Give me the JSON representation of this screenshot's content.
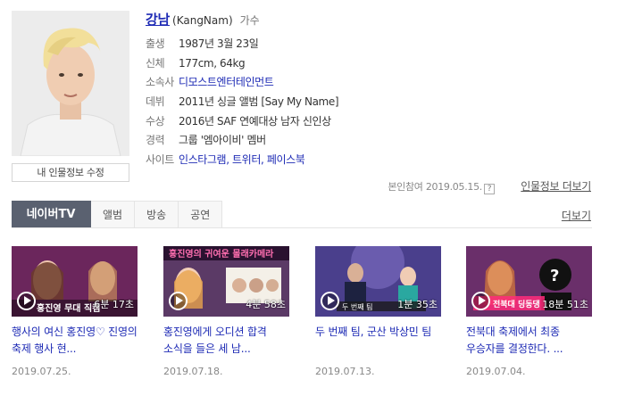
{
  "profile": {
    "name": "강남",
    "name_en": "(KangNam)",
    "job": "가수",
    "edit_button": "내 인물정보 수정",
    "rows": [
      {
        "label": "출생",
        "value": "1987년 3월 23일"
      },
      {
        "label": "신체",
        "value": "177cm, 64kg"
      },
      {
        "label": "소속사",
        "value": "디모스트엔터테인먼트"
      },
      {
        "label": "데뷔",
        "value": "2011년 싱글 앨범 [Say My Name]"
      },
      {
        "label": "수상",
        "value": "2016년 SAF 연예대상 남자 신인상"
      },
      {
        "label": "경력",
        "value": "그룹 '엠아이비' 멤버"
      },
      {
        "label": "사이트",
        "links": [
          "인스타그램",
          "트위터",
          "페이스북"
        ]
      }
    ],
    "verify_text": "본인참여 2019.05.15.",
    "help_mark": "?",
    "more_info": "인물정보 더보기"
  },
  "tabs": [
    {
      "label": "네이버TV",
      "active": true
    },
    {
      "label": "앨범",
      "active": false
    },
    {
      "label": "방송",
      "active": false
    },
    {
      "label": "공연",
      "active": false
    }
  ],
  "more_link": "더보기",
  "videos": [
    {
      "title": "행사의 여신 홍진영♡ 진영의 축제 행사 현...",
      "date": "2019.07.25.",
      "duration": "6분 17초",
      "overlay": "홍진영 무대 직캠",
      "bg": "#3a1f4d"
    },
    {
      "title": "홍진영에게 오디션 합격 소식을 들은 세 남...",
      "date": "2019.07.18.",
      "duration": "4분 58초",
      "overlay": "홍진영의 귀여운 몰래카메라",
      "bg": "#5b3a66"
    },
    {
      "title": "두 번째 팀, 군산 박상민 팀",
      "date": "2019.07.13.",
      "duration": "1분 35초",
      "overlay": "두 번째 팀",
      "bg": "#4a3f8c"
    },
    {
      "title": "전북대 축제에서 최종 우승자를 결정한다. ...",
      "date": "2019.07.04.",
      "duration": "18분 51초",
      "overlay": "전북대 딩동댕",
      "bg": "#6a2f6a"
    }
  ],
  "colors": {
    "link": "#1e2bb5",
    "tab_active": "#5a6170",
    "accent_pink": "#ff2b7a"
  }
}
